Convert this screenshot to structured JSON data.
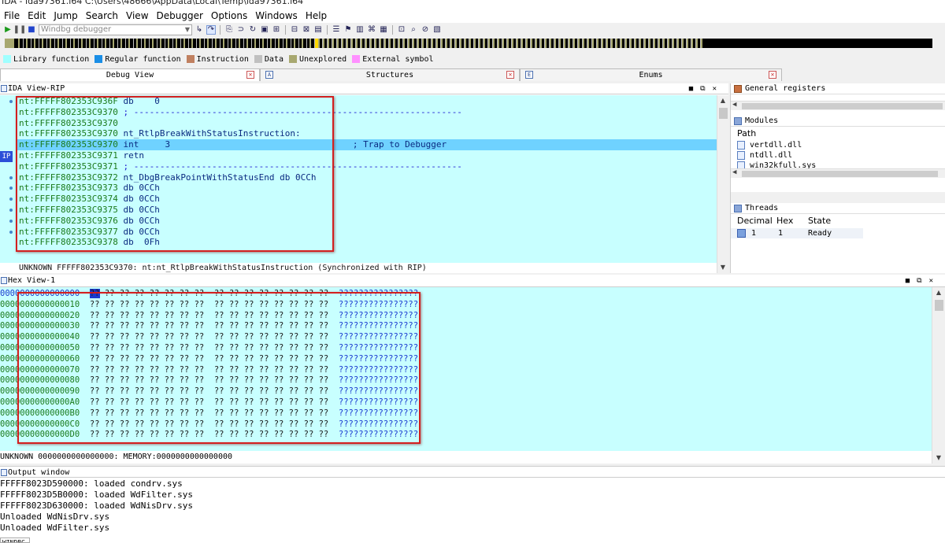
{
  "title": "IDA - ida97361.i64 C:\\Users\\48666\\AppData\\Local\\Temp\\ida97361.i64",
  "menu": [
    "File",
    "Edit",
    "Jump",
    "Search",
    "View",
    "Debugger",
    "Options",
    "Windows",
    "Help"
  ],
  "toolbar": {
    "debugger_select": "Windbg debugger"
  },
  "legend": [
    {
      "label": "Library function",
      "color": "#a0ffff"
    },
    {
      "label": "Regular function",
      "color": "#1a8ee6"
    },
    {
      "label": "Instruction",
      "color": "#c08060"
    },
    {
      "label": "Data",
      "color": "#c0c0c0"
    },
    {
      "label": "Unexplored",
      "color": "#a8a870"
    },
    {
      "label": "External symbol",
      "color": "#ff90ff"
    }
  ],
  "tabs": {
    "debug_view": "Debug View",
    "structures": "Structures",
    "enums": "Enums"
  },
  "ida_view": {
    "title": "IDA View-RIP",
    "rip_badge": "IP",
    "lines": [
      {
        "addr": "nt:FFFFF802353C936F",
        "text": " db    0"
      },
      {
        "addr": "nt:FFFFF802353C9370",
        "text": " ; ---------------------------------------------------------------"
      },
      {
        "addr": "nt:FFFFF802353C9370",
        "text": ""
      },
      {
        "addr": "nt:FFFFF802353C9370",
        "text": " nt_RtlpBreakWithStatusInstruction:"
      },
      {
        "addr": "nt:FFFFF802353C9370",
        "text": " int     3                                   ; Trap to Debugger"
      },
      {
        "addr": "nt:FFFFF802353C9371",
        "text": " retn"
      },
      {
        "addr": "nt:FFFFF802353C9371",
        "text": " ; ---------------------------------------------------------------"
      },
      {
        "addr": "nt:FFFFF802353C9372",
        "text": " nt_DbgBreakPointWithStatusEnd db 0CCh"
      },
      {
        "addr": "nt:FFFFF802353C9373",
        "text": " db 0CCh"
      },
      {
        "addr": "nt:FFFFF802353C9374",
        "text": " db 0CCh"
      },
      {
        "addr": "nt:FFFFF802353C9375",
        "text": " db 0CCh"
      },
      {
        "addr": "nt:FFFFF802353C9376",
        "text": " db 0CCh"
      },
      {
        "addr": "nt:FFFFF802353C9377",
        "text": " db 0CCh"
      },
      {
        "addr": "nt:FFFFF802353C9378",
        "text": " db  0Fh"
      }
    ],
    "status": "UNKNOWN FFFFF802353C9370: nt:nt_RtlpBreakWithStatusInstruction (Synchronized with RIP)"
  },
  "registers": {
    "title": "General registers"
  },
  "modules": {
    "title": "Modules",
    "column": "Path",
    "items": [
      "vertdll.dll",
      "ntdll.dll",
      "win32kfull.sys"
    ]
  },
  "threads": {
    "title": "Threads",
    "columns": [
      "Decimal",
      "Hex",
      "State"
    ],
    "rows": [
      {
        "decimal": "1",
        "hex": "1",
        "state": "Ready"
      }
    ]
  },
  "hex_view": {
    "title": "Hex View-1",
    "addresses": [
      "0000000000000000",
      "0000000000000010",
      "0000000000000020",
      "0000000000000030",
      "0000000000000040",
      "0000000000000050",
      "0000000000000060",
      "0000000000000070",
      "0000000000000080",
      "0000000000000090",
      "00000000000000A0",
      "00000000000000B0",
      "00000000000000C0",
      "00000000000000D0"
    ],
    "bytes": "?? ?? ?? ?? ?? ?? ?? ??  ?? ?? ?? ?? ?? ?? ?? ??",
    "ascii": "????????????????",
    "status": "UNKNOWN 0000000000000000: MEMORY:0000000000000000"
  },
  "output": {
    "title": "Output window",
    "lines": [
      "FFFFF8023D590000: loaded condrv.sys",
      "FFFFF8023D5B0000: loaded WdFilter.sys",
      "FFFFF8023D630000: loaded WdNisDrv.sys",
      "Unloaded WdNisDrv.sys",
      "Unloaded WdFilter.sys"
    ]
  },
  "bottom_tab": "WINDBG"
}
